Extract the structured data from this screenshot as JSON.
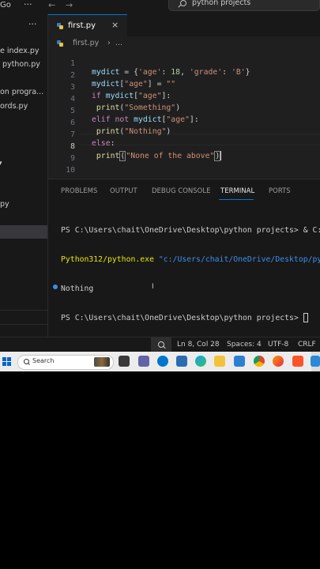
{
  "titlebar": {
    "menu_go": "Go",
    "more": "···",
    "back": "←",
    "forward": "→",
    "search_text": "python projects"
  },
  "sidebar": {
    "more": "···",
    "items": [
      {
        "label": "e index.py"
      },
      {
        "label": "python.py"
      },
      {
        "label": "on progra..."
      },
      {
        "label": "ords.py"
      },
      {
        "label": "py"
      }
    ],
    "chevron": "▾"
  },
  "editor": {
    "tab": {
      "label": "first.py",
      "close": "×"
    },
    "breadcrumb": {
      "file": "first.py",
      "sep": "›",
      "more": "..."
    },
    "line_numbers": [
      "1",
      "2",
      "3",
      "4",
      "5",
      "6",
      "7",
      "8",
      "9",
      "10"
    ],
    "code": {
      "l1": {
        "var": "mydict",
        "eq": " = {",
        "k1": "'age'",
        "c1": ": ",
        "n1": "18",
        "cm": ", ",
        "k2": "'grade'",
        "c2": ": ",
        "s2": "'B'",
        "end": "}"
      },
      "l2": {
        "var": "mydict",
        "b1": "[",
        "key": "\"age\"",
        "b2": "]",
        "eq": " = ",
        "val": "\"\""
      },
      "l3": {
        "kw": "if",
        "sp": " ",
        "var": "mydict",
        "b1": "[",
        "key": "\"age\"",
        "b2": "]",
        "colon": ":"
      },
      "l4": {
        "ind": " ",
        "fn": "print",
        "o": "(",
        "str": "\"Something\"",
        "c": ")"
      },
      "l5": {
        "kw": "elif",
        "sp1": " ",
        "kw2": "not",
        "sp2": " ",
        "var": "mydict",
        "b1": "[",
        "key": "\"age\"",
        "b2": "]",
        "colon": ":"
      },
      "l6": {
        "ind": " ",
        "fn": "print",
        "o": "(",
        "str": "\"Nothing\"",
        "c": ")"
      },
      "l7": {
        "kw": "else",
        "colon": ":"
      },
      "l8": {
        "ind": " ",
        "fn": "print",
        "o": "(",
        "str": "\"None of the above\"",
        "c": ")"
      }
    }
  },
  "panel": {
    "tabs": [
      "PROBLEMS",
      "OUTPUT",
      "DEBUG CONSOLE",
      "TERMINAL",
      "PORTS"
    ],
    "terminal": {
      "line1": "PS C:\\Users\\chait\\OneDrive\\Desktop\\python projects> & C:/",
      "line2_exe": "Python312/python.exe",
      "line2_arg": " \"c:/Users/chait/OneDrive/Desktop/pyt",
      "line3": "Nothing",
      "line4": "PS C:\\Users\\chait\\OneDrive\\Desktop\\python projects> ",
      "ibeam": "I"
    }
  },
  "statusbar": {
    "position": "Ln 8, Col 28",
    "spaces": "Spaces: 4",
    "encoding": "UTF-8",
    "eol": "CRLF"
  },
  "taskbar": {
    "search_placeholder": "Search",
    "apps": [
      "file-explorer",
      "teams",
      "dell",
      "store",
      "edge",
      "folder",
      "photos",
      "chrome",
      "firefox",
      "brave",
      "notepad",
      "vscode"
    ],
    "colors": {
      "accent": "#0078d4",
      "windows_blue": "#0a64c8"
    }
  }
}
